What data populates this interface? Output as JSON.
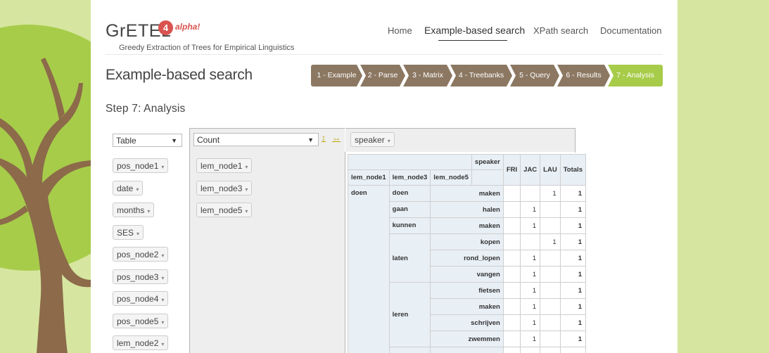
{
  "brand": {
    "name": "GrETEL",
    "version": "4",
    "stage": "alpha!",
    "tagline": "Greedy Extraction of Trees for Empirical Linguistics"
  },
  "nav": {
    "home": "Home",
    "example": "Example-based search",
    "xpath": "XPath search",
    "docs": "Documentation"
  },
  "page_title": "Example-based search",
  "step_title": "Step 7: Analysis",
  "steps": [
    "1 - Example",
    "2 - Parse",
    "3 - Matrix",
    "4 - Treebanks",
    "5 - Query",
    "6 - Results",
    "7 - Analysis"
  ],
  "controls": {
    "renderer": "Table",
    "aggregator": "Count",
    "sort_rows_icon": "↕",
    "sort_cols_icon": "↔"
  },
  "col_attrs": [
    "speaker"
  ],
  "row_attrs": [
    "lem_node1",
    "lem_node3",
    "lem_node5"
  ],
  "unused_attrs": [
    "pos_node1",
    "date",
    "months",
    "SES",
    "pos_node2",
    "pos_node3",
    "pos_node4",
    "pos_node5",
    "lem_node2"
  ],
  "dropdown_arrow": "▾",
  "table": {
    "col_attr_label": "speaker",
    "row_headers": [
      "lem_node1",
      "lem_node3",
      "lem_node5"
    ],
    "col_headers": [
      "FRI",
      "JAC",
      "LAU",
      "Totals"
    ],
    "groups": [
      {
        "node1": "doen",
        "subgroups": [
          {
            "node3": "doen",
            "rows": [
              {
                "node5": "maken",
                "vals": [
                  "",
                  "",
                  "1",
                  "1"
                ]
              }
            ]
          },
          {
            "node3": "gaan",
            "rows": [
              {
                "node5": "halen",
                "vals": [
                  "",
                  "1",
                  "",
                  "1"
                ]
              }
            ]
          },
          {
            "node3": "kunnen",
            "rows": [
              {
                "node5": "maken",
                "vals": [
                  "",
                  "1",
                  "",
                  "1"
                ]
              }
            ]
          },
          {
            "node3": "laten",
            "rows": [
              {
                "node5": "kopen",
                "vals": [
                  "",
                  "",
                  "1",
                  "1"
                ]
              },
              {
                "node5": "rond_lopen",
                "vals": [
                  "",
                  "1",
                  "",
                  "1"
                ]
              },
              {
                "node5": "vangen",
                "vals": [
                  "",
                  "1",
                  "",
                  "1"
                ]
              }
            ]
          },
          {
            "node3": "leren",
            "rows": [
              {
                "node5": "fietsen",
                "vals": [
                  "",
                  "1",
                  "",
                  "1"
                ]
              },
              {
                "node5": "maken",
                "vals": [
                  "",
                  "1",
                  "",
                  "1"
                ]
              },
              {
                "node5": "schrijven",
                "vals": [
                  "",
                  "1",
                  "",
                  "1"
                ]
              },
              {
                "node5": "zwemmen",
                "vals": [
                  "",
                  "1",
                  "",
                  "1"
                ]
              }
            ]
          }
        ]
      }
    ]
  },
  "colors": {
    "side_bg": "#d6e6a0",
    "tree_leaf": "#a7cc4a",
    "tree_trunk": "#8c6a4a",
    "step_inactive": "#8c7862",
    "step_active": "#a7cc4a",
    "badge": "#d9534f"
  }
}
